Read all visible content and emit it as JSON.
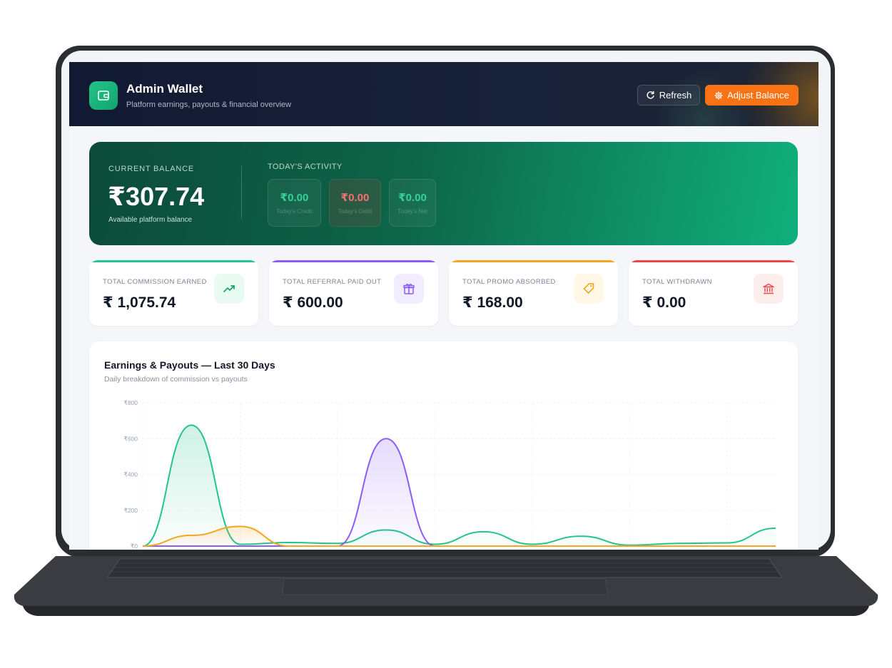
{
  "header": {
    "title": "Admin Wallet",
    "subtitle": "Platform earnings, payouts & financial overview",
    "refresh_label": "Refresh",
    "adjust_label": "Adjust Balance"
  },
  "balance": {
    "label": "CURRENT BALANCE",
    "amount": "₹307.74",
    "note": "Available platform balance"
  },
  "activity": {
    "label": "TODAY'S ACTIVITY",
    "items": [
      {
        "value": "₹0.00",
        "caption": "Today's Credit",
        "color": "#34d399"
      },
      {
        "value": "₹0.00",
        "caption": "Today's Debit",
        "color": "#f87171"
      },
      {
        "value": "₹0.00",
        "caption": "Today's Net",
        "color": "#34d399"
      }
    ]
  },
  "stats": [
    {
      "label": "TOTAL COMMISSION EARNED",
      "value": "₹ 1,075.74",
      "accent": "#22c58b",
      "icon": "trending-up-icon",
      "icon_bg": "#e9fbf3",
      "icon_color": "#16a36e"
    },
    {
      "label": "TOTAL REFERRAL PAID OUT",
      "value": "₹ 600.00",
      "accent": "#8b5cf6",
      "icon": "gift-icon",
      "icon_bg": "#f1ecff",
      "icon_color": "#8b5cf6"
    },
    {
      "label": "TOTAL PROMO ABSORBED",
      "value": "₹ 168.00",
      "accent": "#f5a524",
      "icon": "tag-icon",
      "icon_bg": "#fff8e6",
      "icon_color": "#f59e0b"
    },
    {
      "label": "TOTAL WITHDRAWN",
      "value": "₹ 0.00",
      "accent": "#ef4444",
      "icon": "bank-icon",
      "icon_bg": "#fdeeee",
      "icon_color": "#ef4444"
    }
  ],
  "chart_section": {
    "title": "Earnings & Payouts — Last 30 Days",
    "subtitle": "Daily breakdown of commission vs payouts"
  },
  "chart_data": {
    "type": "area",
    "ylim": [
      0,
      800
    ],
    "yticks": [
      "₹0",
      "₹200",
      "₹400",
      "₹600",
      "₹800"
    ],
    "x": [
      0,
      1,
      2,
      3,
      4,
      5,
      6,
      7,
      8,
      9,
      10,
      11,
      12,
      13
    ],
    "grid": true,
    "series": [
      {
        "color": "#22c58b",
        "values": [
          0,
          675,
          10,
          20,
          15,
          90,
          10,
          80,
          10,
          55,
          5,
          15,
          18,
          100
        ]
      },
      {
        "color": "#8b5cf6",
        "values": [
          0,
          0,
          0,
          0,
          0,
          600,
          0,
          0,
          0,
          0,
          0,
          0,
          0,
          0
        ]
      },
      {
        "color": "#f5a524",
        "values": [
          0,
          60,
          110,
          0,
          0,
          0,
          0,
          0,
          0,
          0,
          0,
          0,
          0,
          0
        ]
      }
    ]
  }
}
